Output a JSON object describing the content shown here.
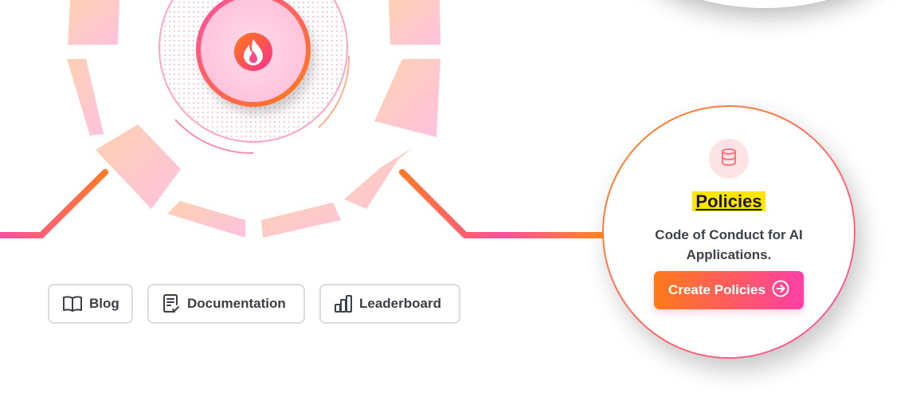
{
  "nav": {
    "blog_label": "Blog",
    "docs_label": "Documentation",
    "leaderboard_label": "Leaderboard"
  },
  "policy_card": {
    "title": "Policies",
    "description": "Code of Conduct for AI Applications.",
    "button_label": "Create Policies",
    "icon": "database-icon",
    "button_icon": "arrow-right-circle-icon"
  },
  "center_logo": {
    "icon": "flame-icon"
  },
  "colors": {
    "gradient_start": "#ff7a18",
    "gradient_end": "#ff3fa4",
    "highlight": "#ffe500",
    "text_dark": "#3d4149",
    "button_border": "#dcdcdc"
  }
}
